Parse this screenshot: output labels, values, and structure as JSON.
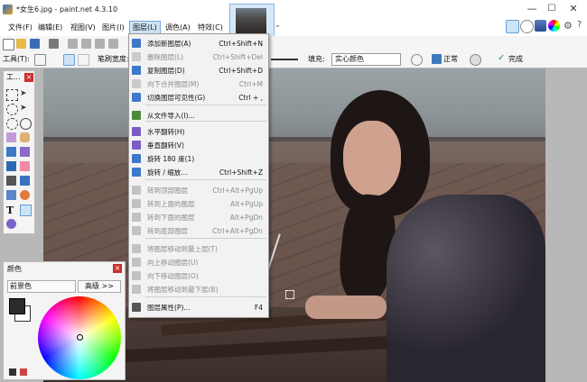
{
  "window": {
    "title": "*女生6.jpg - paint.net 4.3.10",
    "min_glyph": "—",
    "max_glyph": "☐",
    "close_glyph": "✕"
  },
  "menubar": {
    "items": [
      "文件(F)",
      "编辑(E)",
      "视图(V)",
      "图片(I)",
      "图层(L)",
      "调色(A)",
      "特效(C)"
    ]
  },
  "toolbar2": {
    "tools_label": "工具(T):",
    "brush_label": "笔刷宽度:",
    "fill_label": "填充:",
    "fill_value": "实心颜色",
    "blend_label": "正常",
    "finish_label": "完成"
  },
  "tools_panel": {
    "title": "工..."
  },
  "colors_panel": {
    "title": "颜色",
    "select_value": "前景色",
    "more_label": "高级 >>"
  },
  "layers_menu": {
    "items": [
      {
        "label": "添加新图层(A)",
        "shortcut": "Ctrl+Shift+N",
        "disabled": false,
        "icon": "add-layer-icon"
      },
      {
        "label": "删除图层(L)",
        "shortcut": "Ctrl+Shift+Del",
        "disabled": true,
        "icon": "delete-layer-icon"
      },
      {
        "label": "复制图层(D)",
        "shortcut": "Ctrl+Shift+D",
        "disabled": false,
        "icon": "duplicate-layer-icon"
      },
      {
        "label": "向下合并图层(M)",
        "shortcut": "Ctrl+M",
        "disabled": true,
        "icon": "merge-down-icon"
      },
      {
        "label": "切换图层可见性(G)",
        "shortcut": "Ctrl + ,",
        "disabled": false,
        "icon": "visibility-icon"
      },
      {
        "label": "从文件导入(I)...",
        "shortcut": "",
        "disabled": false,
        "icon": "import-icon"
      },
      {
        "label": "水平翻转(H)",
        "shortcut": "",
        "disabled": false,
        "icon": "flip-horizontal-icon"
      },
      {
        "label": "垂直翻转(V)",
        "shortcut": "",
        "disabled": false,
        "icon": "flip-vertical-icon"
      },
      {
        "label": "旋转 180 度(1)",
        "shortcut": "",
        "disabled": false,
        "icon": "rotate-180-icon"
      },
      {
        "label": "旋转 / 缩放...",
        "shortcut": "Ctrl+Shift+Z",
        "disabled": false,
        "icon": "rotate-zoom-icon"
      },
      {
        "label": "转到顶部图层",
        "shortcut": "Ctrl+Alt+PgUp",
        "disabled": true,
        "icon": "go-top-icon"
      },
      {
        "label": "转到上面的图层",
        "shortcut": "Alt+PgUp",
        "disabled": true,
        "icon": "go-up-icon"
      },
      {
        "label": "转到下面的图层",
        "shortcut": "Alt+PgDn",
        "disabled": true,
        "icon": "go-down-icon"
      },
      {
        "label": "转到底部图层",
        "shortcut": "Ctrl+Alt+PgDn",
        "disabled": true,
        "icon": "go-bottom-icon"
      },
      {
        "label": "将图层移动到最上层(T)",
        "shortcut": "",
        "disabled": true,
        "icon": "move-top-icon"
      },
      {
        "label": "向上移动图层(U)",
        "shortcut": "",
        "disabled": true,
        "icon": "move-up-icon"
      },
      {
        "label": "向下移动图层(O)",
        "shortcut": "",
        "disabled": true,
        "icon": "move-down-icon"
      },
      {
        "label": "将图层移动到最下层(B)",
        "shortcut": "",
        "disabled": true,
        "icon": "move-bottom-icon"
      },
      {
        "label": "图层属性(P)...",
        "shortcut": "F4",
        "disabled": false,
        "icon": "properties-icon"
      }
    ]
  },
  "colors": {
    "accent": "#0078d7",
    "menu_highlight": "#cce4f7",
    "panel_close": "#c9302c",
    "primary_color": "#2b2b2b",
    "secondary_color": "#ffffff"
  }
}
